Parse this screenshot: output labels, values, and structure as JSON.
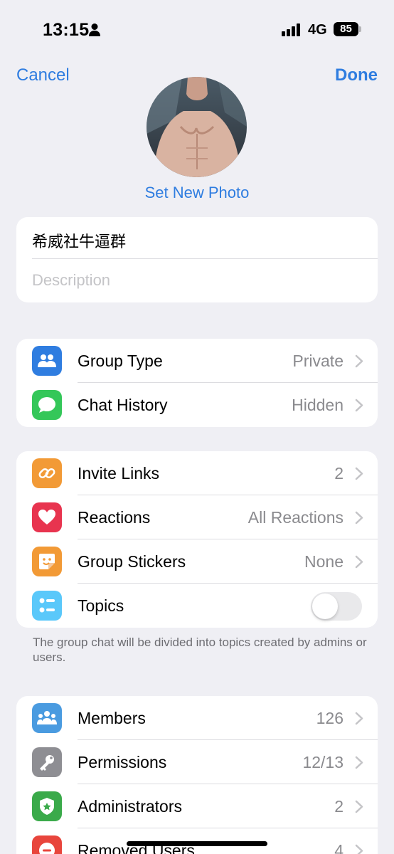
{
  "status_bar": {
    "time": "13:15",
    "network": "4G",
    "battery": "85"
  },
  "nav": {
    "cancel": "Cancel",
    "done": "Done"
  },
  "photo": {
    "set_label": "Set New Photo"
  },
  "info": {
    "group_name": "希威社牛逼群",
    "description_placeholder": "Description"
  },
  "section1": [
    {
      "label": "Group Type",
      "value": "Private",
      "icon": "group-icon",
      "color": "#2f7de0"
    },
    {
      "label": "Chat History",
      "value": "Hidden",
      "icon": "chat-bubble-icon",
      "color": "#34c759"
    }
  ],
  "section2": [
    {
      "label": "Invite Links",
      "value": "2",
      "icon": "link-icon",
      "color": "#f29a36"
    },
    {
      "label": "Reactions",
      "value": "All Reactions",
      "icon": "heart-icon",
      "color": "#e8344f"
    },
    {
      "label": "Group Stickers",
      "value": "None",
      "icon": "sticker-icon",
      "color": "#f29a36"
    },
    {
      "label": "Topics",
      "value": "",
      "icon": "topics-list-icon",
      "color": "#5ac8fa",
      "toggle": false
    }
  ],
  "topics_note": "The group chat will be divided into topics created by admins or users.",
  "section3": [
    {
      "label": "Members",
      "value": "126",
      "icon": "members-icon",
      "color": "#4a9be0"
    },
    {
      "label": "Permissions",
      "value": "12/13",
      "icon": "key-icon",
      "color": "#8e8e93"
    },
    {
      "label": "Administrators",
      "value": "2",
      "icon": "admin-badge-icon",
      "color": "#3aaa4a"
    },
    {
      "label": "Removed Users",
      "value": "4",
      "icon": "removed-user-icon",
      "color": "#e8453c"
    }
  ]
}
